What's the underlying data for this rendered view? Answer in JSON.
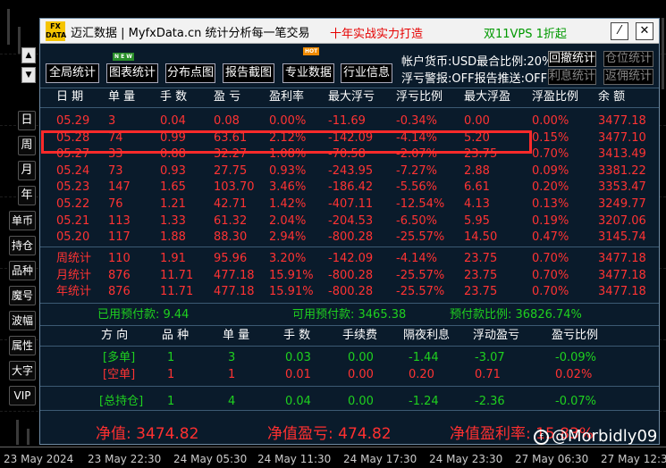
{
  "window": {
    "logo_text": "FX DATA",
    "title": "迈汇数据 | MyfxData.cn  统计分析每一笔交易",
    "slogan": "十年实战实力打造",
    "vps_text": "双11VPS 1折起",
    "minimize_label": "⁄",
    "close_label": "✕"
  },
  "left_axis_buttons": [
    "日",
    "周",
    "月",
    "年",
    "单币",
    "持仓",
    "品种",
    "魔号",
    "波幅",
    "属性",
    "大字",
    "VIP"
  ],
  "toolbar": {
    "buttons": [
      "全局统计",
      "图表统计",
      "分布点图",
      "报告截图",
      "专业数据",
      "行业信息"
    ],
    "badge_new": "N E W",
    "badge_hot": "HOT",
    "account_line1": "帐户货币:USD最合比例:20%",
    "account_line2": "浮亏警报:OFF报告推送:OFF",
    "btn_recall": "回撤统计",
    "btn_position": "仓位统计",
    "btn_interest": "利息统计",
    "btn_rebate": "返佣统计"
  },
  "table": {
    "headers": [
      "日 期",
      "单 量",
      "手 数",
      "盈 亏",
      "盈利率",
      "最大浮亏",
      "浮亏比例",
      "最大浮盈",
      "浮盈比例",
      "余 额"
    ],
    "rows": [
      [
        "05.29",
        "3",
        "0.04",
        "0.08",
        "0.00%",
        "-11.69",
        "-0.34%",
        "0.00",
        "0.00%",
        "3477.18"
      ],
      [
        "05.28",
        "74",
        "0.99",
        "63.61",
        "2.12%",
        "-142.09",
        "-4.14%",
        "5.20",
        "0.15%",
        "3477.10"
      ],
      [
        "05.27",
        "33",
        "0.88",
        "32.27",
        "1.08%",
        "-70.58",
        "-2.07%",
        "23.75",
        "0.70%",
        "3413.49"
      ],
      [
        "05.24",
        "73",
        "0.93",
        "27.75",
        "0.93%",
        "-243.95",
        "-7.27%",
        "2.88",
        "0.09%",
        "3381.22"
      ],
      [
        "05.23",
        "147",
        "1.65",
        "103.70",
        "3.46%",
        "-186.42",
        "-5.56%",
        "6.61",
        "0.20%",
        "3353.47"
      ],
      [
        "05.22",
        "76",
        "1.21",
        "42.71",
        "1.42%",
        "-407.11",
        "-12.54%",
        "4.13",
        "0.13%",
        "3249.77"
      ],
      [
        "05.21",
        "113",
        "1.33",
        "61.32",
        "2.04%",
        "-204.53",
        "-6.50%",
        "5.95",
        "0.19%",
        "3207.06"
      ],
      [
        "05.20",
        "117",
        "1.88",
        "88.30",
        "2.94%",
        "-800.28",
        "-25.57%",
        "14.50",
        "0.47%",
        "3145.74"
      ]
    ],
    "stats": [
      [
        "周统计",
        "110",
        "1.91",
        "95.96",
        "3.20%",
        "-142.09",
        "-4.14%",
        "23.75",
        "0.70%",
        "3477.18"
      ],
      [
        "月统计",
        "876",
        "11.71",
        "477.18",
        "15.91%",
        "-800.28",
        "-25.57%",
        "23.75",
        "0.70%",
        "3477.18"
      ],
      [
        "年统计",
        "876",
        "11.71",
        "477.18",
        "15.91%",
        "-800.28",
        "-25.57%",
        "23.75",
        "0.70%",
        "3477.18"
      ]
    ]
  },
  "margin": {
    "used": "已用预付款: 9.44",
    "available": "可用预付款: 3465.38",
    "ratio": "预付款比例: 36826.74%"
  },
  "positions": {
    "headers": [
      "方 向",
      "品 种",
      "单 量",
      "手 数",
      "手续费",
      "隔夜利息",
      "浮动盈亏",
      "盈亏比例"
    ],
    "rows": [
      [
        "[多单]",
        "1",
        "3",
        "0.03",
        "0.00",
        "-1.44",
        "-3.07",
        "-0.09%"
      ],
      [
        "[空单]",
        "1",
        "1",
        "0.01",
        "0.00",
        "0.20",
        "0.71",
        "0.02%"
      ],
      [
        "[总持仓]",
        "1",
        "4",
        "0.04",
        "0.00",
        "-1.24",
        "-2.36",
        "-0.07%"
      ]
    ]
  },
  "net": {
    "value": "净值: 3474.82",
    "pnl": "净值盈亏: 474.82",
    "rate": "净值盈利率: 15.83%"
  },
  "time_axis": [
    "23 May 2024",
    "23 May 22:30",
    "24 May 05:30",
    "24 May 11:30",
    "24 May 17:30",
    "24 May 23:30",
    "27 May 06:30",
    "27 May 12:30"
  ],
  "watermark": "@Morbidly09",
  "watermark_icon": "f"
}
